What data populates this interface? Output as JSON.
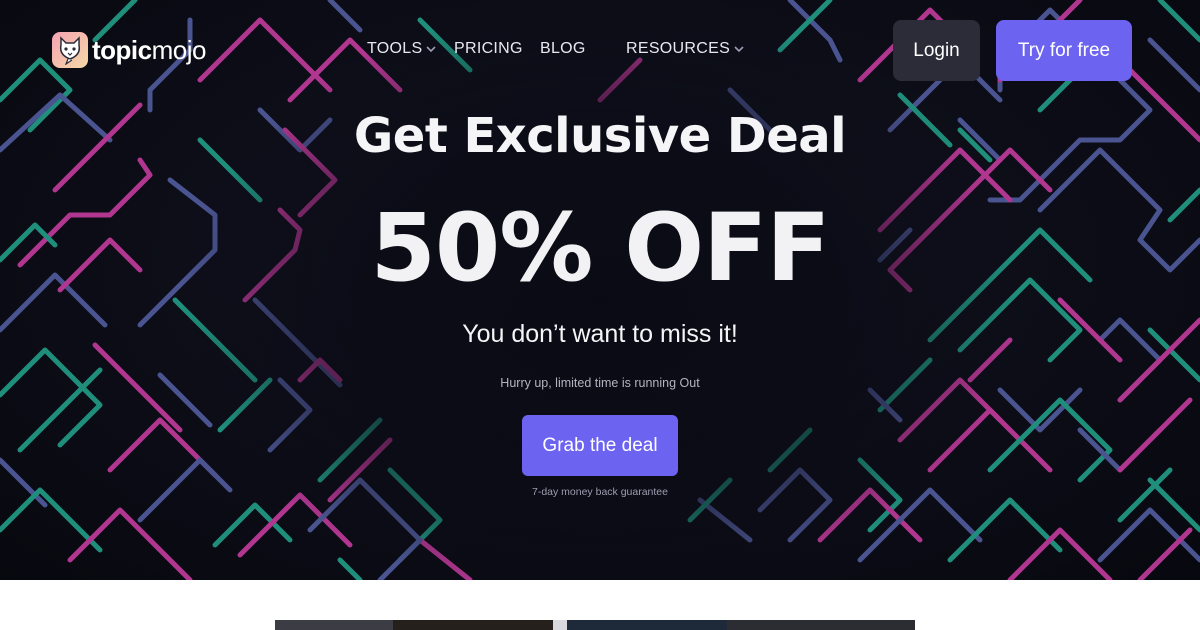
{
  "brand": {
    "name_bold": "topic",
    "name_light": "mojo"
  },
  "nav": {
    "tools": "TOOLS",
    "pricing": "PRICING",
    "blog": "BLOG",
    "resources": "RESOURCES",
    "login": "Login",
    "try_free": "Try for free"
  },
  "hero": {
    "headline": "Get Exclusive Deal",
    "discount": "50% OFF",
    "subline": "You don’t want to miss it!",
    "urgency": "Hurry up, limited time is running Out",
    "cta": "Grab the deal",
    "guarantee": "7-day money back guarantee"
  },
  "colors": {
    "accent": "#6c63f0",
    "login_bg": "#2b2c37",
    "hero_bg": "#0c0d17",
    "neon_pink": "#b0368f",
    "neon_teal": "#1f8f7c",
    "neon_blue": "#4a5490"
  }
}
